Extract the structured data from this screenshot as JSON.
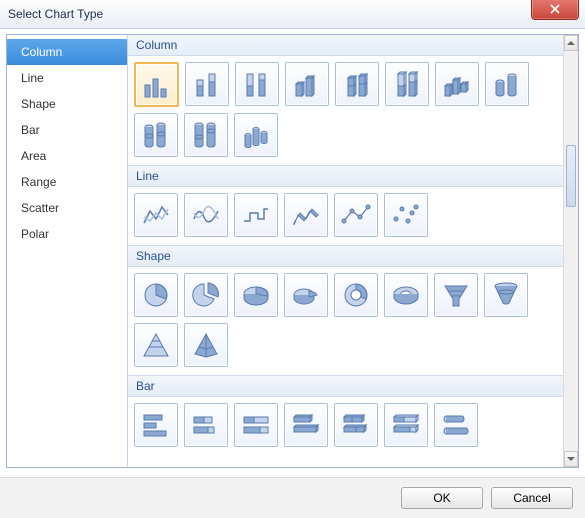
{
  "window": {
    "title": "Select Chart Type"
  },
  "sidebar": {
    "items": [
      {
        "label": "Column",
        "selected": true
      },
      {
        "label": "Line"
      },
      {
        "label": "Shape"
      },
      {
        "label": "Bar"
      },
      {
        "label": "Area"
      },
      {
        "label": "Range"
      },
      {
        "label": "Scatter"
      },
      {
        "label": "Polar"
      }
    ]
  },
  "groups": {
    "column": {
      "label": "Column"
    },
    "line": {
      "label": "Line"
    },
    "shape": {
      "label": "Shape"
    },
    "bar": {
      "label": "Bar"
    }
  },
  "footer": {
    "ok": "OK",
    "cancel": "Cancel"
  },
  "colors": {
    "accent": "#3b8ddc",
    "icon_fill": "#8aa8d0",
    "icon_stroke": "#5a7bb0"
  }
}
